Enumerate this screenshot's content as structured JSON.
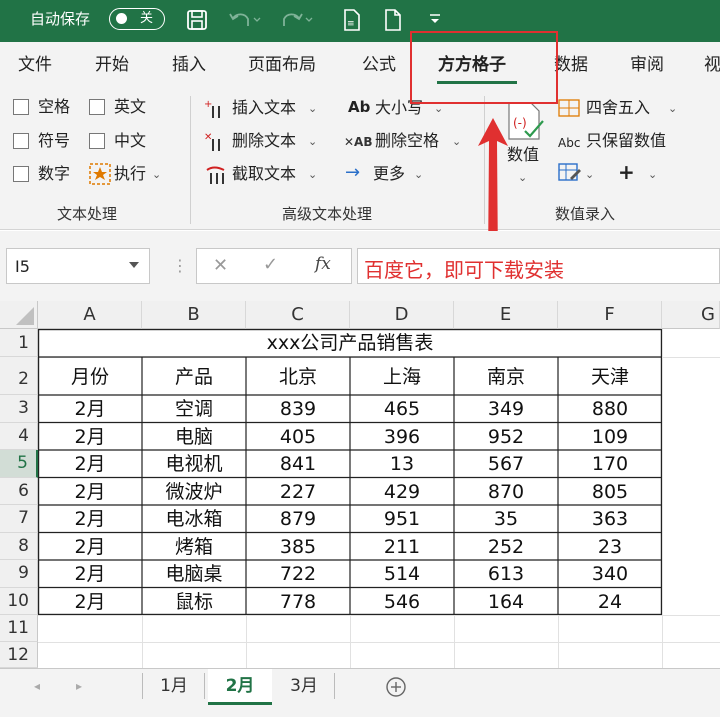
{
  "title_bar": {
    "autosave_label": "自动保存",
    "autosave_state": "关",
    "bg_color": "#217346"
  },
  "menu_tabs": [
    "文件",
    "开始",
    "插入",
    "页面布局",
    "公式",
    "方方格子",
    "数据",
    "审阅",
    "视"
  ],
  "active_tab": "方方格子",
  "ribbon": {
    "checkboxes": [
      "空格",
      "英文",
      "符号",
      "中文",
      "数字"
    ],
    "execute_label": "执行",
    "group1_label": "文本处理",
    "insert_text": "插入文本",
    "delete_text": "删除文本",
    "extract_text": "截取文本",
    "case_label": "大小写",
    "delete_space": "删除空格",
    "more_label": "更多",
    "group2_label": "高级文本处理",
    "value_label": "数值",
    "round_label": "四舍五入",
    "keep_values": "只保留数值",
    "group3_label": "数值录入",
    "abc_small": "Abc",
    "ab_small": "Ab",
    "x_ab_small": "✕AB"
  },
  "formula_bar": {
    "name_box": "I5",
    "fx": "fx",
    "formula_text": "百度它，即可下载安装"
  },
  "grid": {
    "columns": [
      "A",
      "B",
      "C",
      "D",
      "E",
      "F",
      "G"
    ],
    "rows": [
      "1",
      "2",
      "3",
      "4",
      "5",
      "6",
      "7",
      "8",
      "9",
      "10",
      "11",
      "12"
    ],
    "table_title": "xxx公司产品销售表",
    "headers": [
      "月份",
      "产品",
      "北京",
      "上海",
      "南京",
      "天津"
    ],
    "data": [
      [
        "2月",
        "空调",
        "839",
        "465",
        "349",
        "880"
      ],
      [
        "2月",
        "电脑",
        "405",
        "396",
        "952",
        "109"
      ],
      [
        "2月",
        "电视机",
        "841",
        "13",
        "567",
        "170"
      ],
      [
        "2月",
        "微波炉",
        "227",
        "429",
        "870",
        "805"
      ],
      [
        "2月",
        "电冰箱",
        "879",
        "951",
        "35",
        "363"
      ],
      [
        "2月",
        "烤箱",
        "385",
        "211",
        "252",
        "23"
      ],
      [
        "2月",
        "电脑桌",
        "722",
        "514",
        "613",
        "340"
      ],
      [
        "2月",
        "鼠标",
        "778",
        "546",
        "164",
        "24"
      ]
    ]
  },
  "sheet_tabs": [
    "1月",
    "2月",
    "3月"
  ],
  "active_sheet": "2月",
  "annotation_color": "#e03030"
}
